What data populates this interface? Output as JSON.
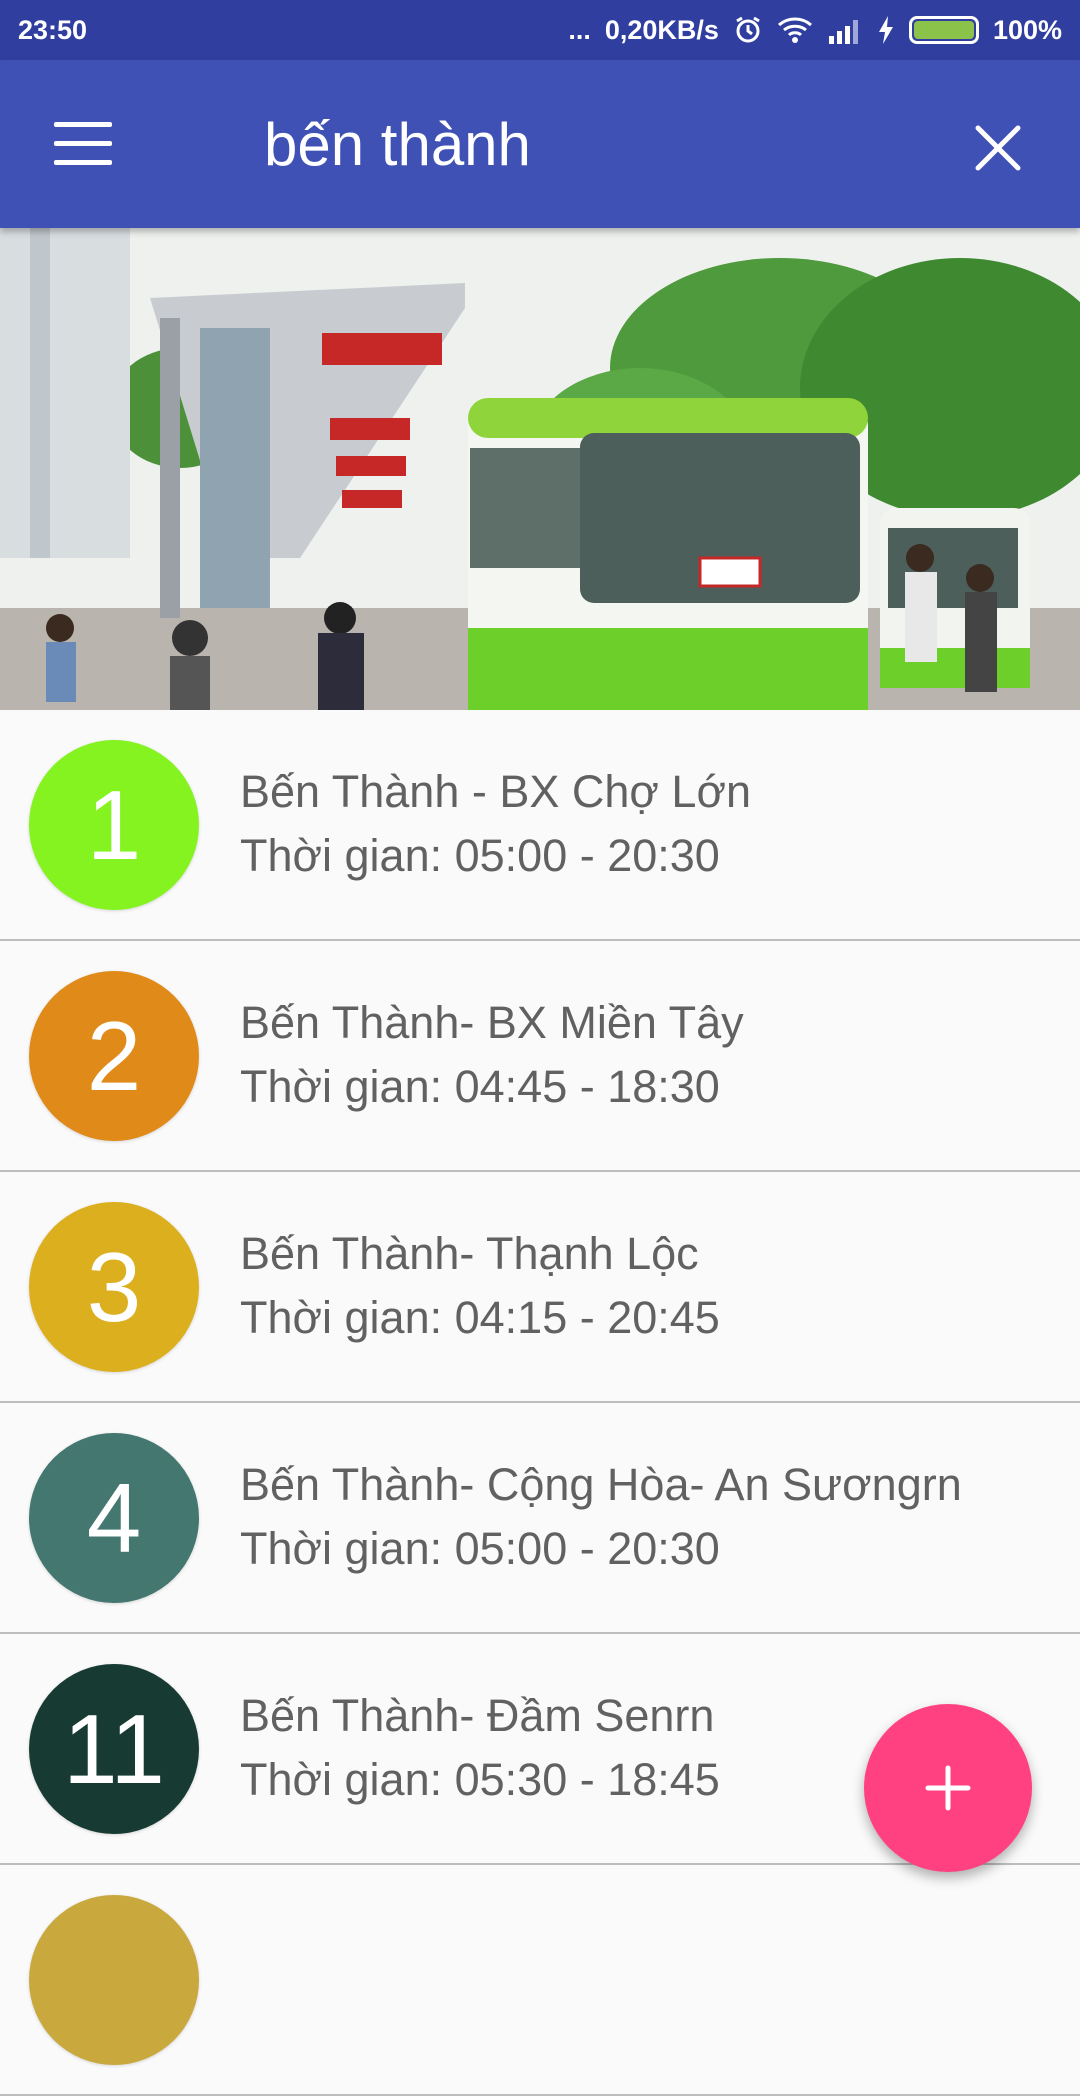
{
  "status_bar": {
    "time": "23:50",
    "dots": "...",
    "speed": "0,20KB/s",
    "battery": "100%",
    "icons": [
      "alarm-icon",
      "wifi-icon",
      "signal-icon",
      "charging-icon",
      "battery-icon"
    ]
  },
  "app_bar": {
    "search_query": "bến thành",
    "menu_icon": "menu-icon",
    "close_icon": "close-icon"
  },
  "hero": {
    "image": "bus-station-photo"
  },
  "routes": [
    {
      "number": "1",
      "title": "Bến Thành - BX Chợ Lớn",
      "time": "Thời gian: 05:00 - 20:30",
      "color": "#84f320"
    },
    {
      "number": "2",
      "title": "Bến Thành- BX Miền Tây",
      "time": "Thời gian: 04:45 - 18:30",
      "color": "#e08a1a"
    },
    {
      "number": "3",
      "title": "Bến Thành- Thạnh Lộc",
      "time": "Thời gian: 04:15 - 20:45",
      "color": "#dcaf1e"
    },
    {
      "number": "4",
      "title": "Bến Thành- Cộng Hòa- An Sươngrn",
      "time": "Thời gian: 05:00 - 20:30",
      "color": "#43776f"
    },
    {
      "number": "11",
      "title": "Bến Thành- Đầm Senrn",
      "time": "Thời gian: 05:30 - 18:45",
      "color": "#173b32"
    },
    {
      "number": "",
      "title": "",
      "time": "",
      "color": "#c9a83e"
    }
  ],
  "fab": {
    "icon": "plus-icon",
    "color": "#ff4081"
  },
  "colors": {
    "status_bar": "#303f9f",
    "app_bar": "#3f51b5",
    "list_text": "#616161",
    "divider": "#bdbdbd"
  }
}
